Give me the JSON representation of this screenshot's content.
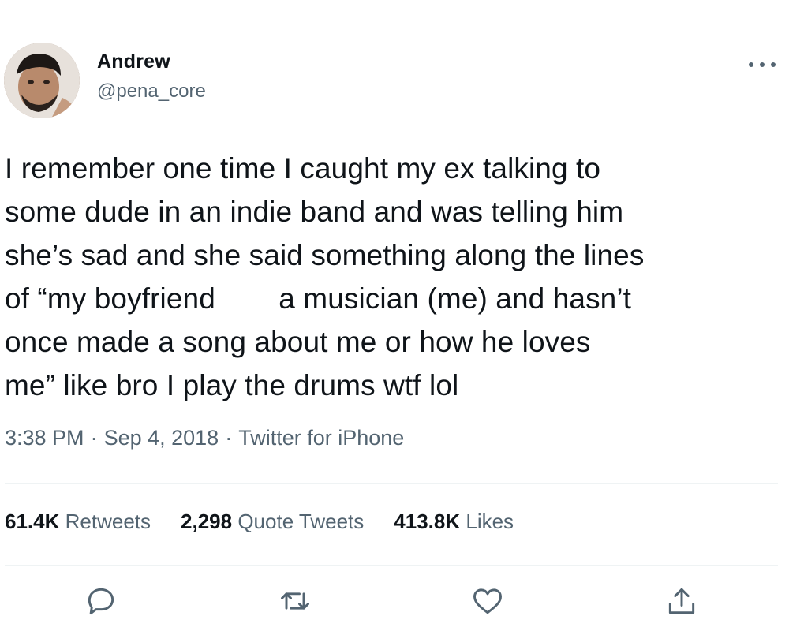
{
  "author": {
    "name": "Andrew",
    "handle": "@pena_core"
  },
  "tweet": {
    "lines": [
      "I remember one time I caught my ex talking to",
      "some dude in an indie band and was telling him",
      "she’s sad and she said something along the lines",
      "once made a song about me or how he loves",
      "me” like bro I play the drums wtf lol"
    ],
    "line4_before": "of  “my boyfriend ",
    "line4_after": "a musician (me) and hasn’t"
  },
  "meta": {
    "time": "3:38 PM",
    "separator": "·",
    "date": "Sep 4, 2018",
    "source": "Twitter for iPhone"
  },
  "stats": {
    "retweets_count": "61.4K",
    "retweets_label": "Retweets",
    "quotes_count": "2,298",
    "quotes_label": "Quote Tweets",
    "likes_count": "413.8K",
    "likes_label": "Likes"
  },
  "icons": {
    "more": "more-icon",
    "reply": "reply-icon",
    "retweet": "retweet-icon",
    "like": "heart-icon",
    "share": "share-icon"
  },
  "colors": {
    "text": "#0f1419",
    "secondary": "#536471",
    "divider": "#eff3f4"
  }
}
